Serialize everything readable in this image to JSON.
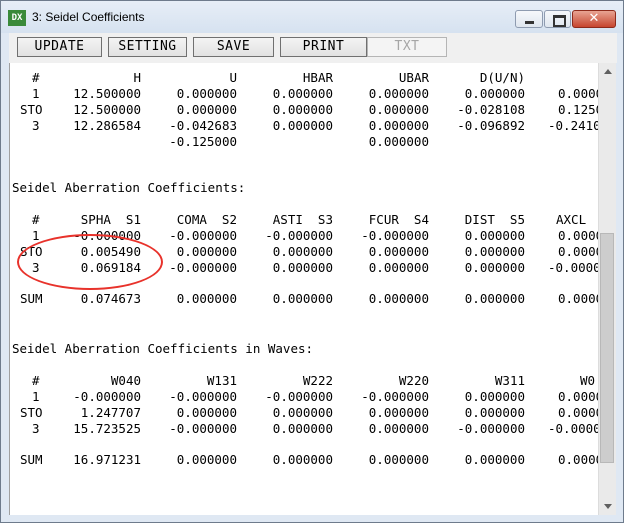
{
  "window": {
    "app_icon": "DX",
    "title": "3: Seidel Coefficients",
    "close_glyph": "✕"
  },
  "toolbar": {
    "update": "UPDATE",
    "setting": "SETTING",
    "save": "SAVE",
    "print": "PRINT",
    "txt": "TXT"
  },
  "paraxial": {
    "headers": [
      "#",
      "H",
      "U",
      "HBAR",
      "UBAR",
      "D(U/N)",
      ""
    ],
    "rows": [
      [
        "1",
        "12.500000",
        "0.000000",
        "0.000000",
        "0.000000",
        "0.000000",
        "0.0000"
      ],
      [
        "STO",
        "12.500000",
        "0.000000",
        "0.000000",
        "0.000000",
        "-0.028108",
        "0.1250"
      ],
      [
        "3",
        "12.286584",
        "-0.042683",
        "0.000000",
        "0.000000",
        "-0.096892",
        "-0.2410"
      ],
      [
        "",
        "",
        "-0.125000",
        "",
        "0.000000",
        "",
        ""
      ]
    ]
  },
  "seidel": {
    "title": "Seidel Aberration Coefficients:",
    "headers": [
      "#",
      "SPHA  S1",
      "COMA  S2",
      "ASTI  S3",
      "FCUR  S4",
      "DIST  S5",
      "AXCL"
    ],
    "rows": [
      [
        "1",
        "-0.000000",
        "-0.000000",
        "-0.000000",
        "-0.000000",
        "0.000000",
        "0.0000"
      ],
      [
        "STO",
        "0.005490",
        "0.000000",
        "0.000000",
        "0.000000",
        "0.000000",
        "0.0000"
      ],
      [
        "3",
        "0.069184",
        "-0.000000",
        "0.000000",
        "0.000000",
        "0.000000",
        "-0.0000"
      ]
    ],
    "sum": [
      "SUM",
      "0.074673",
      "0.000000",
      "0.000000",
      "0.000000",
      "0.000000",
      "0.0000"
    ]
  },
  "waves": {
    "title": "Seidel Aberration Coefficients in Waves:",
    "headers": [
      "#",
      "W040",
      "W131",
      "W222",
      "W220",
      "W311",
      "W0"
    ],
    "rows": [
      [
        "1",
        "-0.000000",
        "-0.000000",
        "-0.000000",
        "-0.000000",
        "0.000000",
        "0.0000"
      ],
      [
        "STO",
        "1.247707",
        "0.000000",
        "0.000000",
        "0.000000",
        "0.000000",
        "0.0000"
      ],
      [
        "3",
        "15.723525",
        "-0.000000",
        "0.000000",
        "0.000000",
        "-0.000000",
        "-0.0000"
      ]
    ],
    "sum": [
      "SUM",
      "16.971231",
      "0.000000",
      "0.000000",
      "0.000000",
      "0.000000",
      "0.0000"
    ]
  },
  "annotation": {
    "color": "#e8322b"
  }
}
